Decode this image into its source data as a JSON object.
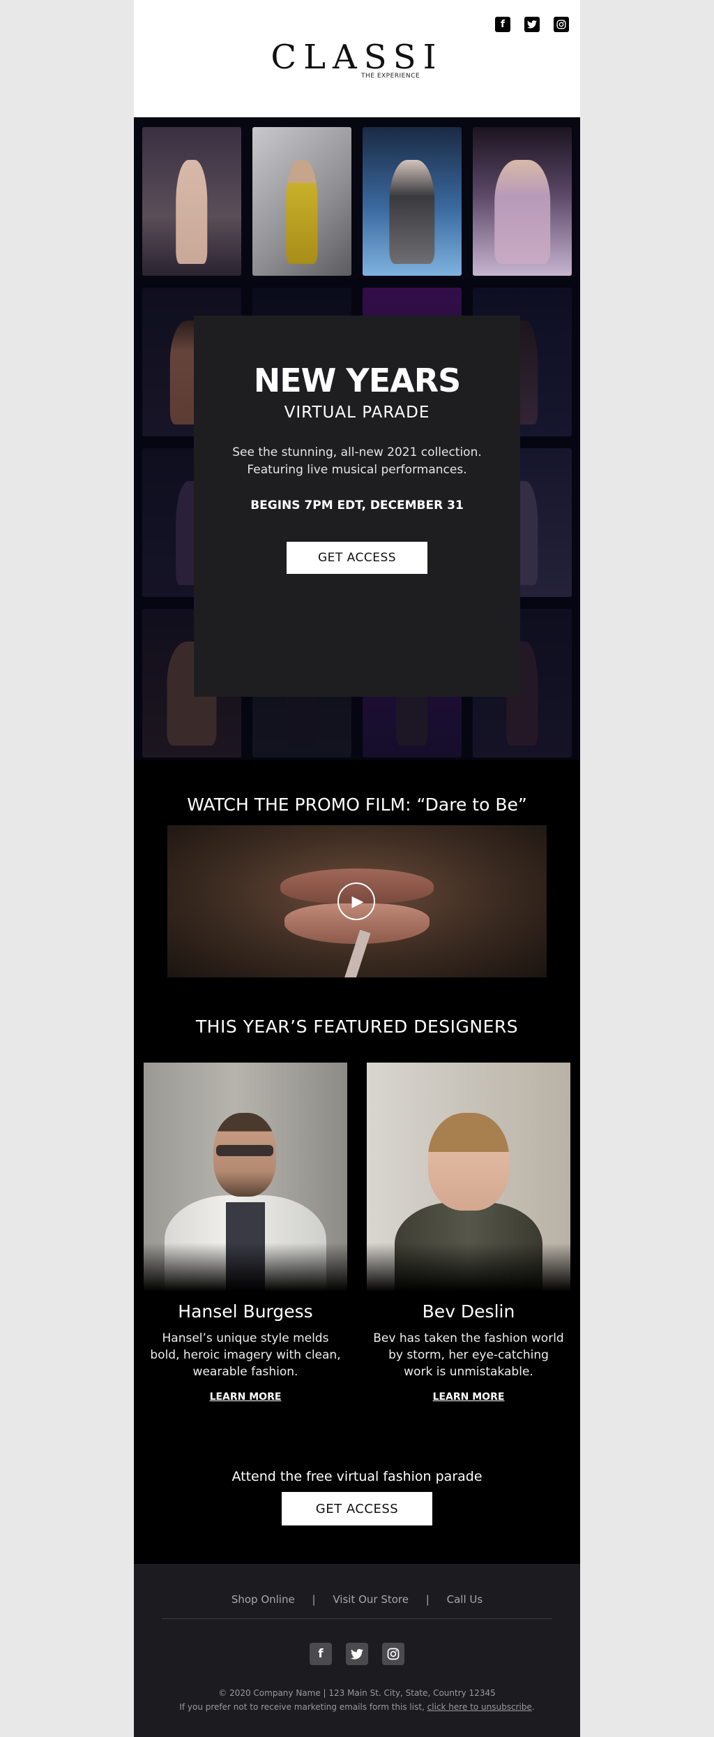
{
  "header": {
    "logo": "CLASSI",
    "tagline": "THE EXPERIENCE",
    "social": [
      "facebook-icon",
      "twitter-icon",
      "instagram-icon"
    ]
  },
  "hero": {
    "title": "NEW YEARS",
    "subtitle": "VIRTUAL PARADE",
    "desc_line1": "See the stunning, all-new 2021 collection.",
    "desc_line2": "Featuring live musical performances.",
    "date": "BEGINS 7PM EDT, DECEMBER 31",
    "button": "GET ACCESS"
  },
  "promo": {
    "title": "WATCH THE PROMO FILM: “Dare to Be”",
    "play_icon": "play-icon"
  },
  "designers": {
    "title": "THIS YEAR’S FEATURED DESIGNERS",
    "items": [
      {
        "name": "Hansel Burgess",
        "bio": "Hansel’s unique style melds bold, heroic imagery with clean, wearable fashion.",
        "link": "LEARN MORE"
      },
      {
        "name": "Bev Deslin",
        "bio": "Bev has taken the fashion world by storm, her eye-catching work is unmistakable.",
        "link": "LEARN MORE"
      }
    ]
  },
  "cta": {
    "text": "Attend the free virtual fashion parade",
    "button": "GET ACCESS"
  },
  "footer": {
    "links": [
      "Shop Online",
      "Visit Our Store",
      "Call Us"
    ],
    "separator": "|",
    "address": "© 2020 Company Name | 123 Main St. City, State, Country 12345",
    "unsub_prefix": "If you prefer not to receive marketing emails form this list, ",
    "unsub_link": "click here to unsubscribe",
    "unsub_suffix": "."
  },
  "colors": {
    "page_bg": "#e8e8e8",
    "email_bg": "#000000",
    "card_bg": "#1e1e21",
    "footer_bg": "#1c1c20"
  }
}
